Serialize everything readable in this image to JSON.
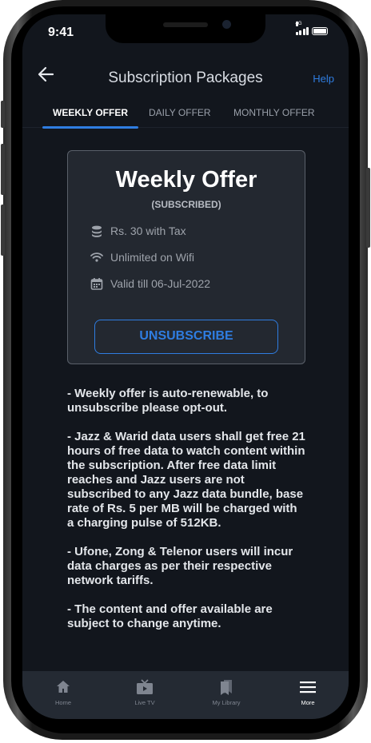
{
  "status": {
    "time": "9:41",
    "network": "4G"
  },
  "header": {
    "title": "Subscription Packages",
    "help_label": "Help",
    "back_icon": "back-arrow-icon"
  },
  "tabs": [
    {
      "label": "WEEKLY OFFER",
      "active": true
    },
    {
      "label": "DAILY OFFER",
      "active": false
    },
    {
      "label": "MONTHLY OFFER",
      "active": false
    }
  ],
  "offer": {
    "title": "Weekly Offer",
    "status": "(SUBSCRIBED)",
    "features": [
      {
        "icon": "coins-icon",
        "text": "Rs. 30 with Tax"
      },
      {
        "icon": "wifi-icon",
        "text": "Unlimited on Wifi"
      },
      {
        "icon": "calendar-icon",
        "text": "Valid till 06-Jul-2022"
      }
    ],
    "button_label": "UNSUBSCRIBE"
  },
  "terms": [
    "- Weekly offer is auto-renewable, to unsubscribe please opt-out.",
    "- Jazz & Warid data users shall get free 21 hours of free data to watch content within the subscription. After free data limit reaches and Jazz users are not subscribed to any Jazz data bundle, base rate of Rs. 5 per MB will be charged with a charging pulse of 512KB.",
    "- Ufone, Zong & Telenor users will incur data charges as per their respective network tariffs.",
    "- The content and offer available are subject to change anytime."
  ],
  "bottom_nav": [
    {
      "label": "Home",
      "icon": "home-icon",
      "active": false
    },
    {
      "label": "Live TV",
      "icon": "tv-icon",
      "active": false
    },
    {
      "label": "My Library",
      "icon": "bookmark-icon",
      "active": false
    },
    {
      "label": "More",
      "icon": "menu-icon",
      "active": true
    }
  ],
  "colors": {
    "accent": "#2f7de1",
    "background": "#12161d",
    "card": "#232830",
    "nav": "#242a33"
  }
}
